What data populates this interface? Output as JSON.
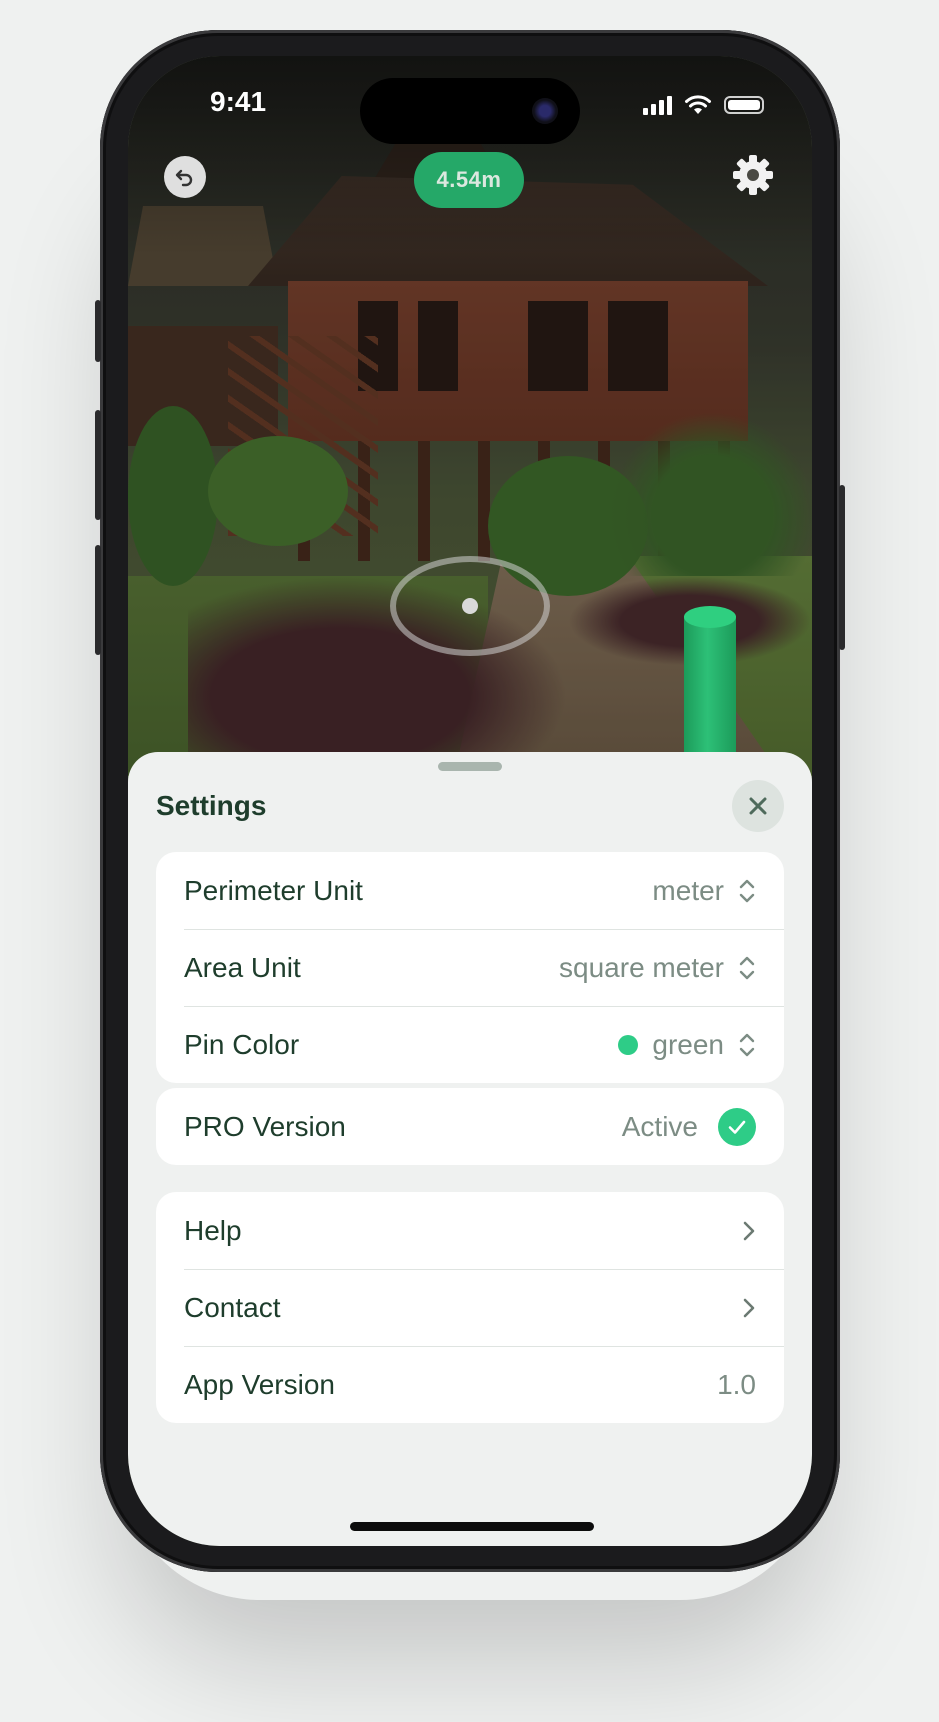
{
  "status_bar": {
    "time": "9:41"
  },
  "overlay": {
    "undo_icon": "undo-arrow-icon",
    "measurement": "4.54m",
    "settings_icon": "gear-icon",
    "pin_color": "#2dc077"
  },
  "settings": {
    "title": "Settings",
    "close_icon": "close-icon",
    "units": [
      {
        "label": "Perimeter Unit",
        "value": "meter"
      },
      {
        "label": "Area Unit",
        "value": "square meter"
      },
      {
        "label": "Pin Color",
        "value": "green",
        "swatch": "#2ecc87"
      }
    ],
    "pro": {
      "label": "PRO Version",
      "value": "Active"
    },
    "info": {
      "help": "Help",
      "contact": "Contact",
      "app_version_label": "App Version",
      "app_version_value": "1.0"
    }
  },
  "colors": {
    "accent": "#2ecc87",
    "text": "#1e3d2c",
    "secondary_text": "#7c8c84",
    "sheet_bg": "#eff1f0"
  }
}
